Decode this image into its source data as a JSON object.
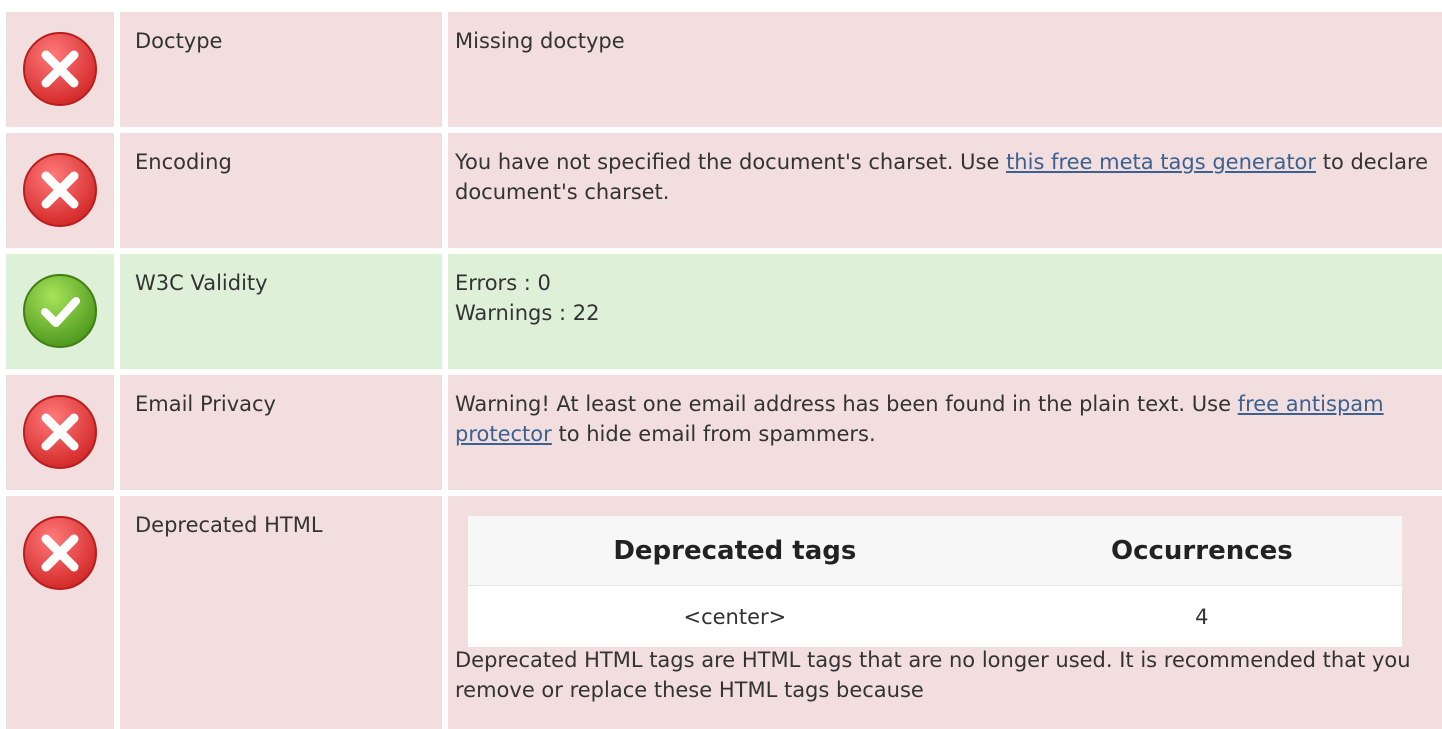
{
  "rows": [
    {
      "status": "error",
      "label": "Doctype",
      "text": "Missing doctype"
    },
    {
      "status": "error",
      "label": "Encoding",
      "text_before": "You have not specified the document's charset. Use ",
      "link": "this free meta tags generator",
      "text_after": " to declare document's charset."
    },
    {
      "status": "ok",
      "label": "W3C Validity",
      "line1": "Errors : 0",
      "line2": "Warnings : 22"
    },
    {
      "status": "error",
      "label": "Email Privacy",
      "text_before": "Warning! At least one email address has been found in the plain text. Use ",
      "link": "free antispam protector",
      "text_after": " to hide email from spammers."
    },
    {
      "status": "error",
      "label": "Deprecated HTML",
      "table": {
        "headers": [
          "Deprecated tags",
          "Occurrences"
        ],
        "rows": [
          [
            "<center>",
            "4"
          ]
        ]
      },
      "description": "Deprecated HTML tags are HTML tags that are no longer used. It is recommended that you remove or replace these HTML tags because"
    }
  ],
  "colors": {
    "error_bg": "#f2dede",
    "ok_bg": "#dff0d8",
    "error_icon": "#e04040",
    "ok_icon": "#6cbf2f",
    "link": "#3a6190"
  },
  "icons": {
    "error": "error-x-icon",
    "ok": "check-icon"
  }
}
